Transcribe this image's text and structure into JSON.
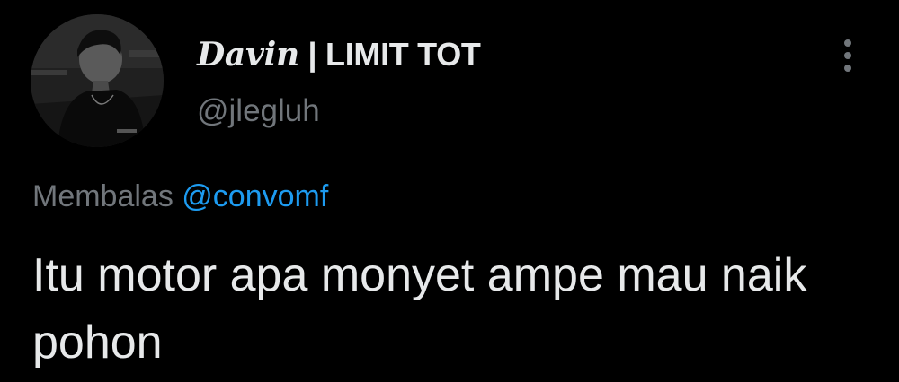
{
  "tweet": {
    "author": {
      "display_name_stylized": "Davin",
      "display_name_rest": " | LIMIT TOT",
      "handle": "@jlegluh",
      "avatar_icon": "user-avatar-photo"
    },
    "reply_context": {
      "prefix": "Membalas ",
      "mention": "@convomf"
    },
    "text": "Itu motor apa monyet ampe mau naik pohon",
    "more_icon": "more-vertical-icon"
  },
  "colors": {
    "background": "#000000",
    "primary_text": "#e7e9ea",
    "secondary_text": "#71767b",
    "link": "#1d9bf0"
  }
}
